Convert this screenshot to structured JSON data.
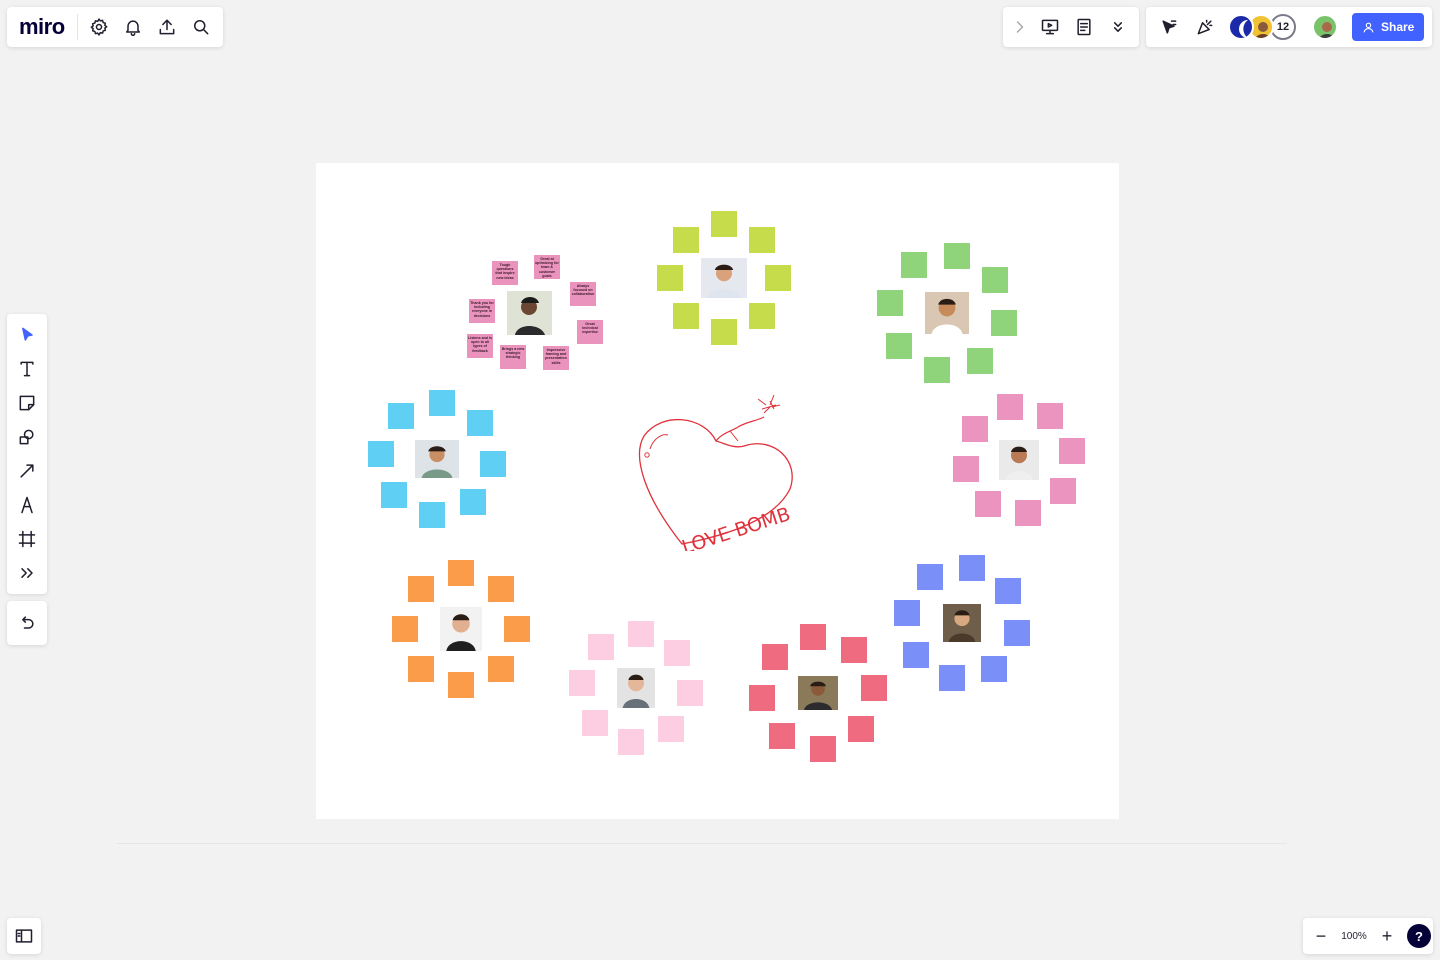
{
  "app": {
    "logo": "miro"
  },
  "top_left_toolbar": {
    "icons": [
      "settings-gear-icon",
      "bell-icon",
      "upload-icon",
      "search-icon"
    ]
  },
  "top_center_toolbar": {
    "icons": [
      "chevron-right-icon",
      "presentation-icon",
      "notes-icon",
      "chevrons-down-icon"
    ]
  },
  "top_right_toolbar": {
    "collaborator_count": "12",
    "share_label": "Share"
  },
  "left_toolbar": {
    "tools": [
      "select-cursor-icon",
      "text-tool-icon",
      "sticky-note-tool-icon",
      "shapes-tool-icon",
      "line-arrow-tool-icon",
      "pen-tool-icon",
      "frame-tool-icon",
      "more-tools-icon"
    ],
    "undo": "undo-icon"
  },
  "board": {
    "center_sketch_text": "LOVE BOMB",
    "pink_cluster_notes": [
      "Tough questions that inspire new ideas",
      "Great at optimizing for team & customer goals",
      "Always focused on collaboration",
      "Thank you for including everyone in decisions",
      "Listens and is open to all types of feedback",
      "Brings a new strategic thinking",
      "Great technical expertise",
      "Impressive framing and presentation skills"
    ],
    "colors": {
      "lime": "#c7dc4a",
      "green": "#8fd47a",
      "cyan": "#5fd0f3",
      "pink": "#ea94bf",
      "orange": "#fb9c4b",
      "light_pink": "#fdcde2",
      "red": "#ee6b80",
      "blue": "#7a8ff8",
      "accent": "#4262ff"
    }
  },
  "zoom": {
    "level": "100%",
    "minus": "−",
    "plus": "+",
    "help": "?"
  }
}
